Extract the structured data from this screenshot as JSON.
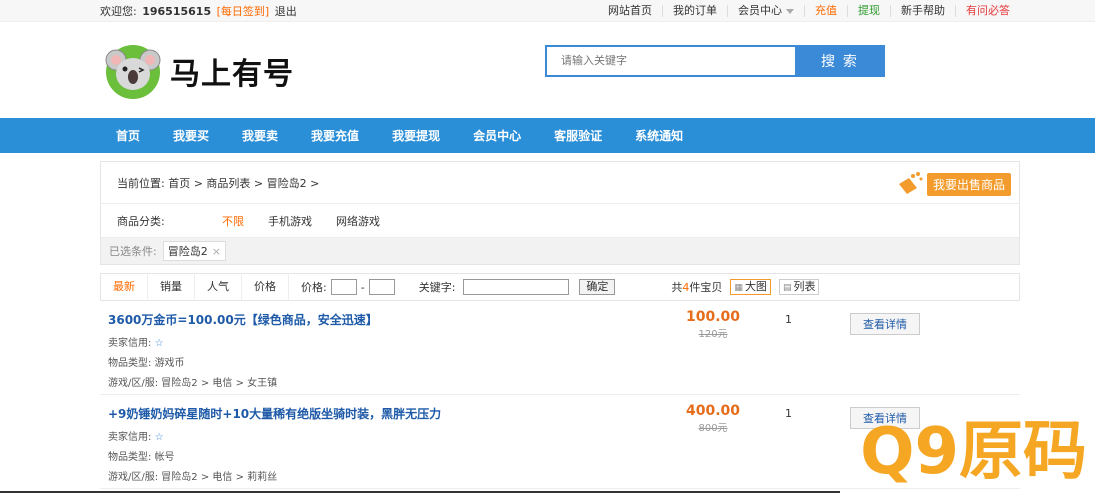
{
  "topbar": {
    "welcome": "欢迎您:",
    "user_id": "196515615",
    "sign_in": "[每日签到]",
    "logout": "退出",
    "links": [
      {
        "label": "网站首页",
        "color": "default"
      },
      {
        "label": "我的订单",
        "color": "default"
      },
      {
        "label": "会员中心",
        "color": "default",
        "dropdown": true
      },
      {
        "label": "充值",
        "color": "orange"
      },
      {
        "label": "提现",
        "color": "green"
      },
      {
        "label": "新手帮助",
        "color": "default"
      },
      {
        "label": "有问必答",
        "color": "red"
      }
    ]
  },
  "header": {
    "logo_text": "马上有号",
    "search_placeholder": "请输入关键字",
    "search_button": "搜 索"
  },
  "nav": [
    "首页",
    "我要买",
    "我要卖",
    "我要充值",
    "我要提现",
    "会员中心",
    "客服验证",
    "系统通知"
  ],
  "breadcrumb": "当前位置: 首页 > 商品列表 > 冒险岛2 >",
  "sell_button": "我要出售商品",
  "category": {
    "label": "商品分类:",
    "options": [
      {
        "label": "不限",
        "active": true
      },
      {
        "label": "手机游戏",
        "active": false
      },
      {
        "label": "网络游戏",
        "active": false
      }
    ]
  },
  "filters": {
    "label": "已选条件:",
    "chip": "冒险岛2",
    "remove": "×"
  },
  "sortbar": {
    "sorts": [
      {
        "label": "最新",
        "active": true
      },
      {
        "label": "销量",
        "active": false
      },
      {
        "label": "人气",
        "active": false
      },
      {
        "label": "价格",
        "active": false
      }
    ],
    "price_label": "价格:",
    "dash": "-",
    "keyword_label": "关键字:",
    "confirm": "确定",
    "count_prefix": "共",
    "count": "4",
    "count_suffix": "件宝贝",
    "view_big": "大图",
    "view_list": "列表"
  },
  "items": [
    {
      "title": "3600万金币=100.00元【绿色商品，安全迅速】",
      "seller_label": "卖家信用:",
      "type_label": "物品类型:",
      "type": "游戏币",
      "server_label": "游戏/区/服:",
      "server": "冒险岛2 > 电信 > 女王镇",
      "price": "100.00",
      "old_price": "120元",
      "qty": "1",
      "detail": "查看详情"
    },
    {
      "title": "+9奶锤奶妈碎星随时+10大量稀有绝版坐骑时装，黑胖无压力",
      "seller_label": "卖家信用:",
      "type_label": "物品类型:",
      "type": "帐号",
      "server_label": "游戏/区/服:",
      "server": "冒险岛2 > 电信 > 莉莉丝",
      "price": "400.00",
      "old_price": "800元",
      "qty": "1",
      "detail": "查看详情"
    }
  ],
  "watermark": {
    "brand": "Q9原码"
  },
  "colors": {
    "accent": "#2b8fd8",
    "orange": "#ff6a00",
    "price": "#e46c1a"
  }
}
